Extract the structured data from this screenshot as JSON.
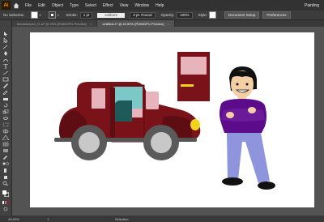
{
  "app": {
    "logo": "Ai",
    "workspace": "Painting"
  },
  "menu": [
    "File",
    "Edit",
    "Object",
    "Type",
    "Select",
    "Effect",
    "View",
    "Window",
    "Help"
  ],
  "control_bar": {
    "selection": "No Selection",
    "stroke_label": "Stroke:",
    "stroke_value": "1 pt",
    "uniform": "Uniform",
    "brush": "3 pt. Round",
    "opacity_label": "Opacity:",
    "opacity_value": "100%",
    "style_label": "Style:",
    "document_setup": "Document Setup",
    "preferences": "Preferences"
  },
  "tabs": [
    {
      "label": "timestamped_f1.ai* @ 25% (RGB/GPU Preview)",
      "close": "×",
      "active": false
    },
    {
      "label": "Untitled-1* @ 43.92% (RGB/GPU Preview)",
      "close": "×",
      "active": true
    }
  ],
  "status": {
    "zoom": "43.92%",
    "page": "1",
    "selection_tool": "Selection"
  },
  "colors": {
    "car_body": "#7a1319",
    "car_dark": "#5e0e13",
    "window_pink": "#e8b4bc",
    "window_teal": "#7cc7c8",
    "seat": "#1f5a5a",
    "tire": "#5a5a5a",
    "hub": "#c8c8c8",
    "headlight": "#f2d31b",
    "shirt": "#5c0c8a",
    "pants": "#8e95dd",
    "skin": "#f4cfa6",
    "hair": "#111111",
    "door_handle": "#f2d31b"
  },
  "icons": {
    "home": "home-icon",
    "selection_tool": "selection-tool-icon",
    "direct_selection": "direct-selection-icon",
    "pen": "pen-tool-icon",
    "type": "type-tool-icon",
    "rectangle": "rectangle-tool-icon"
  }
}
